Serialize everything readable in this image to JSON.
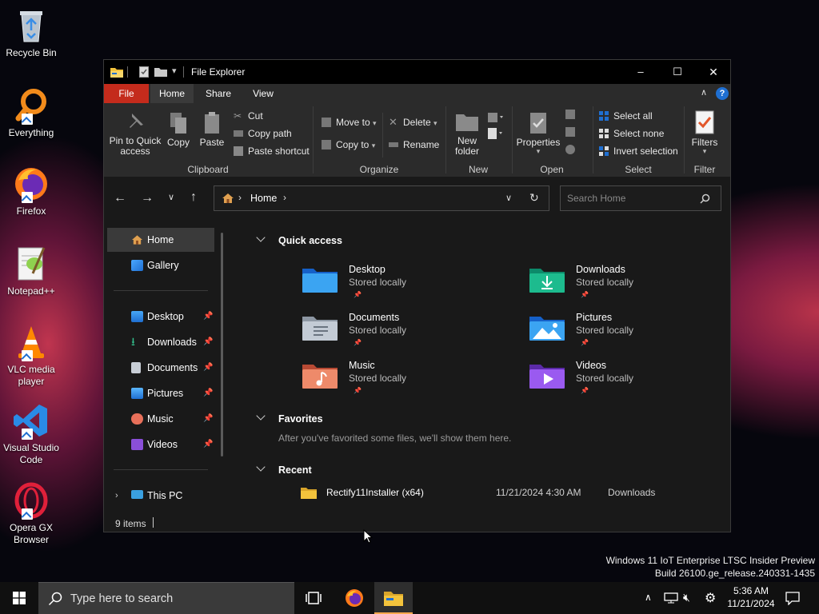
{
  "desktop": {
    "icons": [
      {
        "label": "Recycle Bin"
      },
      {
        "label": "Everything"
      },
      {
        "label": "Firefox"
      },
      {
        "label": "Notepad++"
      },
      {
        "label": "VLC media player"
      },
      {
        "label": "Visual Studio Code"
      },
      {
        "label": "Opera GX Browser"
      }
    ],
    "watermark": {
      "line1": "Windows 11 IoT Enterprise LTSC Insider Preview",
      "line2": "Build 26100.ge_release.240331-1435"
    }
  },
  "window": {
    "title": "File Explorer",
    "controls": {
      "minimize": "–",
      "maximize": "☐",
      "close": "✕"
    },
    "ribbon_tabs": [
      {
        "label": "File"
      },
      {
        "label": "Home"
      },
      {
        "label": "Share"
      },
      {
        "label": "View"
      }
    ],
    "ribbon": {
      "clipboard": {
        "label": "Clipboard",
        "pin": "Pin to Quick access",
        "copy": "Copy",
        "paste": "Paste",
        "cut": "Cut",
        "copy_path": "Copy path",
        "paste_shortcut": "Paste shortcut"
      },
      "organize": {
        "label": "Organize",
        "move_to": "Move to",
        "copy_to": "Copy to",
        "delete": "Delete",
        "rename": "Rename"
      },
      "new": {
        "label": "New",
        "new_folder": "New folder"
      },
      "open": {
        "label": "Open",
        "properties": "Properties"
      },
      "select": {
        "label": "Select",
        "select_all": "Select all",
        "select_none": "Select none",
        "invert_selection": "Invert selection"
      },
      "filter": {
        "label": "Filter",
        "filters": "Filters"
      }
    },
    "address": {
      "location": "Home",
      "search_placeholder": "Search Home"
    },
    "sidebar": {
      "top": [
        {
          "label": "Home"
        },
        {
          "label": "Gallery"
        }
      ],
      "pinned": [
        {
          "label": "Desktop"
        },
        {
          "label": "Downloads"
        },
        {
          "label": "Documents"
        },
        {
          "label": "Pictures"
        },
        {
          "label": "Music"
        },
        {
          "label": "Videos"
        }
      ],
      "this_pc": "This PC"
    },
    "main": {
      "quick_access": {
        "heading": "Quick access",
        "tiles": [
          {
            "name": "Desktop",
            "sub": "Stored locally"
          },
          {
            "name": "Downloads",
            "sub": "Stored locally"
          },
          {
            "name": "Documents",
            "sub": "Stored locally"
          },
          {
            "name": "Pictures",
            "sub": "Stored locally"
          },
          {
            "name": "Music",
            "sub": "Stored locally"
          },
          {
            "name": "Videos",
            "sub": "Stored locally"
          }
        ]
      },
      "favorites": {
        "heading": "Favorites",
        "empty_text": "After you've favorited some files, we'll show them here."
      },
      "recent": {
        "heading": "Recent",
        "items": [
          {
            "name": "Rectify11Installer (x64)",
            "date": "11/21/2024 4:30 AM",
            "location": "Downloads"
          }
        ]
      }
    },
    "status": {
      "items_count": "9 items"
    }
  },
  "taskbar": {
    "search_placeholder": "Type here to search",
    "clock": {
      "time": "5:36 AM",
      "date": "11/21/2024"
    }
  },
  "colors": {
    "file_tab": "#c42b1c",
    "accent_blue": "#1f6fd1",
    "folder_yellow": "#f3c33c"
  }
}
